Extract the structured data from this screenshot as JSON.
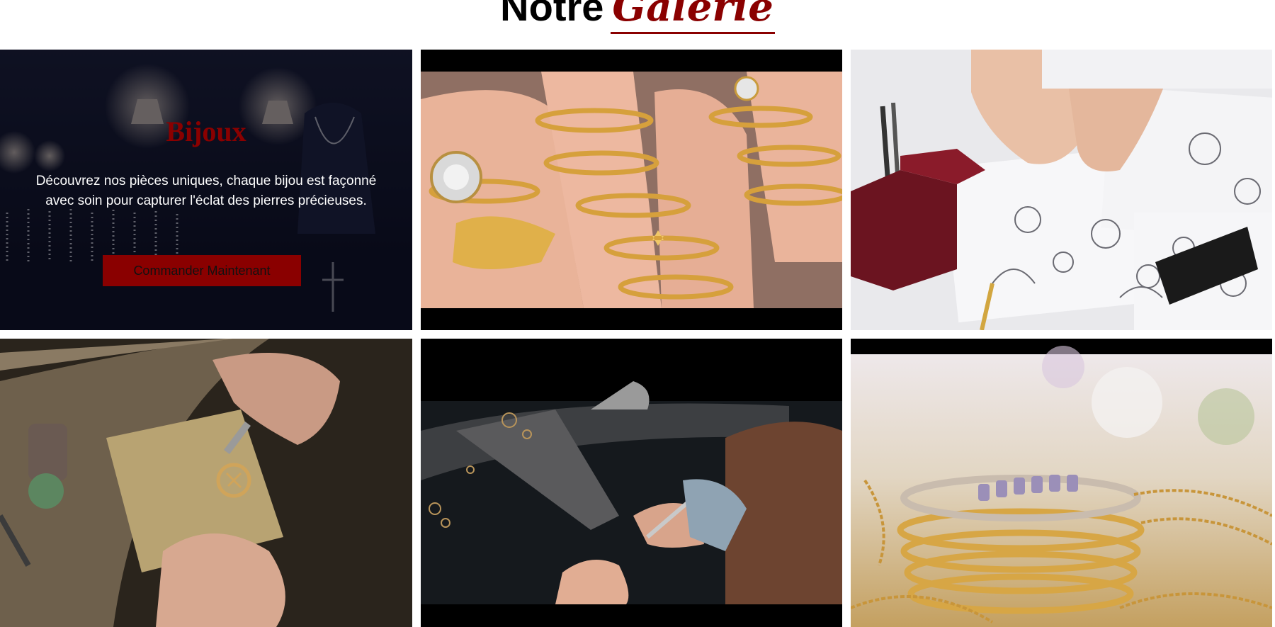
{
  "heading": {
    "word_plain": "Notre",
    "word_accent": "Galerie",
    "accent_color": "#8a0000"
  },
  "gallery": {
    "featured": {
      "title": "Bijoux",
      "description": "Découvrez nos pièces uniques, chaque bijou est façonné avec soin pour capturer l'éclat des pierres précieuses.",
      "button_label": "Commander Maintenant",
      "button_color": "#8a0000"
    },
    "images": [
      {
        "subject": "gold-rings-on-fingers"
      },
      {
        "subject": "jewelry-design-sketches"
      },
      {
        "subject": "artisan-engraving-pendant"
      },
      {
        "subject": "jeweler-workbench"
      },
      {
        "subject": "stacked-gold-rings-and-chains"
      }
    ]
  }
}
